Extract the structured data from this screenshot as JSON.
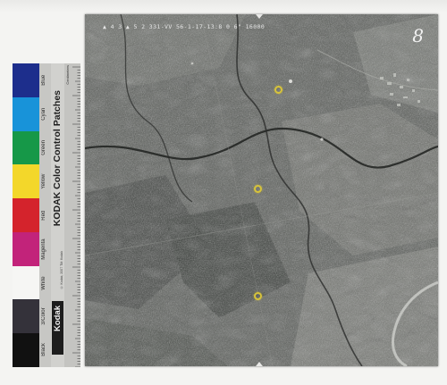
{
  "photo": {
    "caption": "▲ 4 3 ▲ 5 2 331-VV 56-1-17-13:8 0 6\" 16000",
    "frame_number": "8"
  },
  "control_strip": {
    "title": "KODAK Color Control Patches",
    "patches": [
      {
        "label": "Blue",
        "color": "#1d2e8c"
      },
      {
        "label": "Cyan",
        "color": "#1893d9"
      },
      {
        "label": "Green",
        "color": "#169848"
      },
      {
        "label": "Yellow",
        "color": "#f3d72a"
      },
      {
        "label": "Red",
        "color": "#d4232c"
      },
      {
        "label": "Magenta",
        "color": "#c2237a"
      },
      {
        "label": "White",
        "color": "#f6f6f4"
      },
      {
        "label": "3/Color",
        "color": "#34323a"
      },
      {
        "label": "Black",
        "color": "#111111"
      }
    ],
    "fine_print": "© Kodak, 2007   TM: Kodak",
    "logo_text": "Kodak",
    "ruler_unit": "Centimeters"
  },
  "colors": {
    "marker": "#d8c43a",
    "background": "#f4f4f2"
  }
}
